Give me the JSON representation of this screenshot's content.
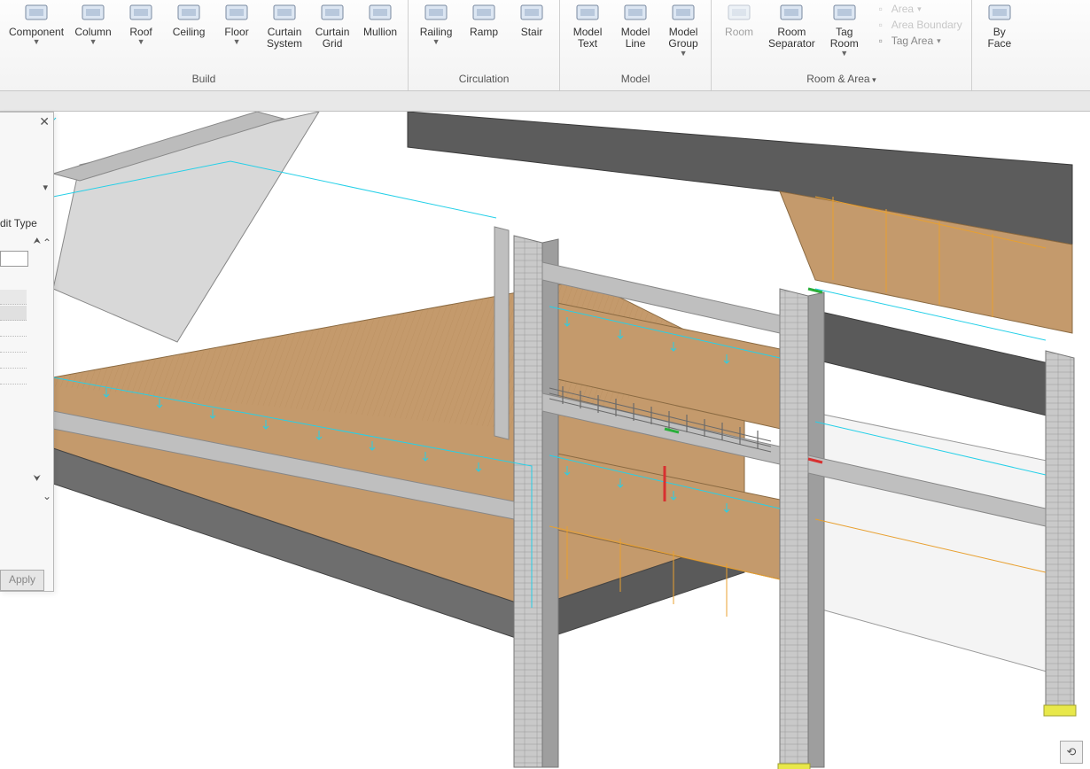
{
  "ribbon": {
    "panels": [
      {
        "label": "Build",
        "tools": [
          {
            "label": "Component",
            "drop": true,
            "icon": "component"
          },
          {
            "label": "Column",
            "drop": true,
            "icon": "column"
          },
          {
            "label": "Roof",
            "drop": true,
            "icon": "roof"
          },
          {
            "label": "Ceiling",
            "drop": false,
            "icon": "ceiling"
          },
          {
            "label": "Floor",
            "drop": true,
            "icon": "floor"
          },
          {
            "label": "Curtain\nSystem",
            "drop": false,
            "icon": "curtain-system"
          },
          {
            "label": "Curtain\nGrid",
            "drop": false,
            "icon": "curtain-grid"
          },
          {
            "label": "Mullion",
            "drop": false,
            "icon": "mullion"
          }
        ]
      },
      {
        "label": "Circulation",
        "tools": [
          {
            "label": "Railing",
            "drop": true,
            "icon": "railing"
          },
          {
            "label": "Ramp",
            "drop": false,
            "icon": "ramp"
          },
          {
            "label": "Stair",
            "drop": false,
            "icon": "stair"
          }
        ]
      },
      {
        "label": "Model",
        "tools": [
          {
            "label": "Model\nText",
            "drop": false,
            "icon": "model-text"
          },
          {
            "label": "Model\nLine",
            "drop": false,
            "icon": "model-line"
          },
          {
            "label": "Model\nGroup",
            "drop": true,
            "icon": "model-group"
          }
        ]
      },
      {
        "label": "Room & Area",
        "label_drop": true,
        "tools": [
          {
            "label": "Room",
            "drop": false,
            "icon": "room",
            "disabled": true
          },
          {
            "label": "Room\nSeparator",
            "drop": false,
            "icon": "room-sep"
          },
          {
            "label": "Tag\nRoom",
            "drop": true,
            "icon": "tag-room"
          }
        ],
        "side": [
          {
            "label": "Area",
            "drop": true,
            "icon": "area",
            "disabled": true
          },
          {
            "label": "Area Boundary",
            "icon": "area-boundary",
            "disabled": true
          },
          {
            "label": "Tag Area",
            "drop": true,
            "icon": "tag-area"
          }
        ]
      },
      {
        "label": "",
        "tools": [
          {
            "label": "By\nFace",
            "drop": false,
            "icon": "by-face"
          }
        ]
      }
    ]
  },
  "properties": {
    "close": "✕",
    "edit_type": "dit Type",
    "apply": "Apply"
  },
  "icons": {
    "component": "📦",
    "column": "▮",
    "roof": "◢",
    "ceiling": "▭",
    "floor": "▬",
    "curtain-system": "▦",
    "curtain-grid": "▤",
    "mullion": "╂",
    "railing": "╫",
    "ramp": "◿",
    "stair": "▤",
    "model-text": "A",
    "model-line": "╱",
    "model-group": "⧉",
    "room": "☐",
    "room-sep": "⫿",
    "tag-room": "◧",
    "area": "▢",
    "area-boundary": "▨",
    "tag-area": "◩",
    "by-face": "◫"
  }
}
